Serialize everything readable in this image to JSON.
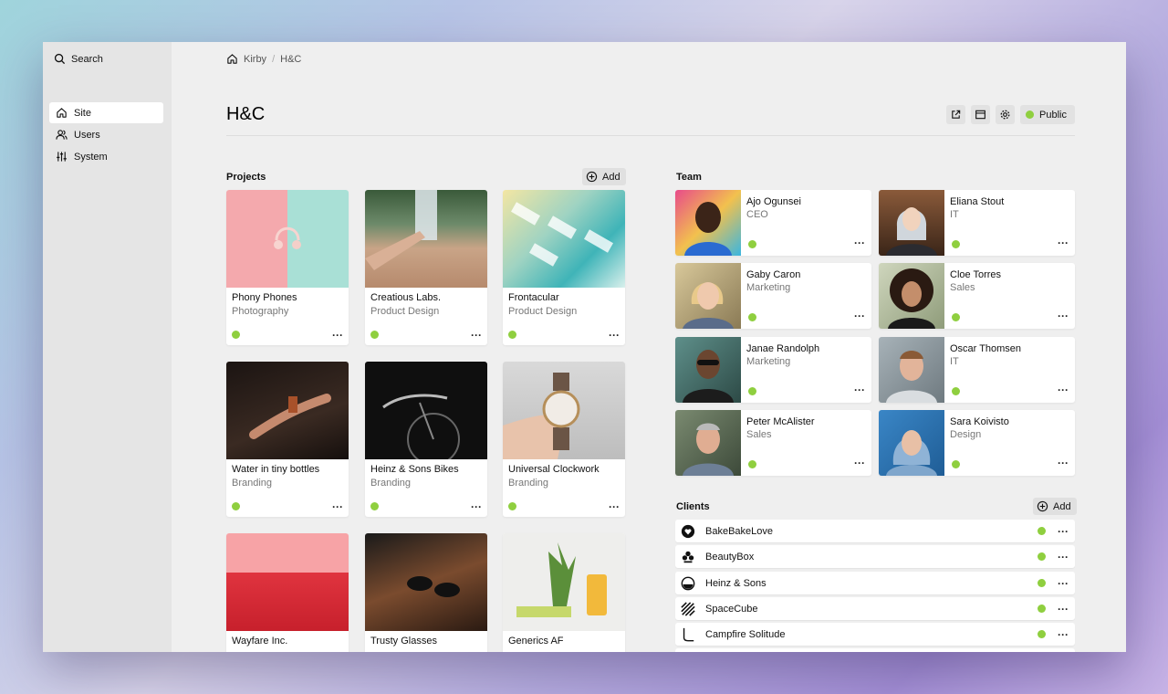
{
  "sidebar": {
    "search_label": "Search",
    "items": [
      {
        "label": "Site",
        "icon": "home-icon",
        "active": true
      },
      {
        "label": "Users",
        "icon": "users-icon",
        "active": false
      },
      {
        "label": "System",
        "icon": "sliders-icon",
        "active": false
      }
    ]
  },
  "breadcrumb": {
    "root": "Kirby",
    "current": "H&C"
  },
  "page": {
    "title": "H&C",
    "status_label": "Public",
    "status_color": "#8fcf3f"
  },
  "projects": {
    "label": "Projects",
    "add_label": "Add",
    "items": [
      {
        "title": "Phony Phones",
        "category": "Photography"
      },
      {
        "title": "Creatious Labs.",
        "category": "Product Design"
      },
      {
        "title": "Frontacular",
        "category": "Product Design"
      },
      {
        "title": "Water in tiny bottles",
        "category": "Branding"
      },
      {
        "title": "Heinz & Sons Bikes",
        "category": "Branding"
      },
      {
        "title": "Universal Clockwork",
        "category": "Branding"
      },
      {
        "title": "Wayfare Inc.",
        "category": ""
      },
      {
        "title": "Trusty Glasses",
        "category": ""
      },
      {
        "title": "Generics AF",
        "category": ""
      }
    ]
  },
  "team": {
    "label": "Team",
    "members": [
      {
        "name": "Ajo Ogunsei",
        "role": "CEO"
      },
      {
        "name": "Eliana Stout",
        "role": "IT"
      },
      {
        "name": "Gaby Caron",
        "role": "Marketing"
      },
      {
        "name": "Cloe Torres",
        "role": "Sales"
      },
      {
        "name": "Janae Randolph",
        "role": "Marketing"
      },
      {
        "name": "Oscar Thomsen",
        "role": "IT"
      },
      {
        "name": "Peter McAlister",
        "role": "Sales"
      },
      {
        "name": "Sara Koivisto",
        "role": "Design"
      }
    ]
  },
  "clients": {
    "label": "Clients",
    "add_label": "Add",
    "items": [
      {
        "name": "BakeBakeLove",
        "icon": "heart-logo-icon"
      },
      {
        "name": "BeautyBox",
        "icon": "flower-logo-icon"
      },
      {
        "name": "Heinz & Sons",
        "icon": "circle-logo-icon"
      },
      {
        "name": "SpaceCube",
        "icon": "stripes-logo-icon"
      },
      {
        "name": "Campfire Solitude",
        "icon": "boot-logo-icon"
      }
    ]
  }
}
